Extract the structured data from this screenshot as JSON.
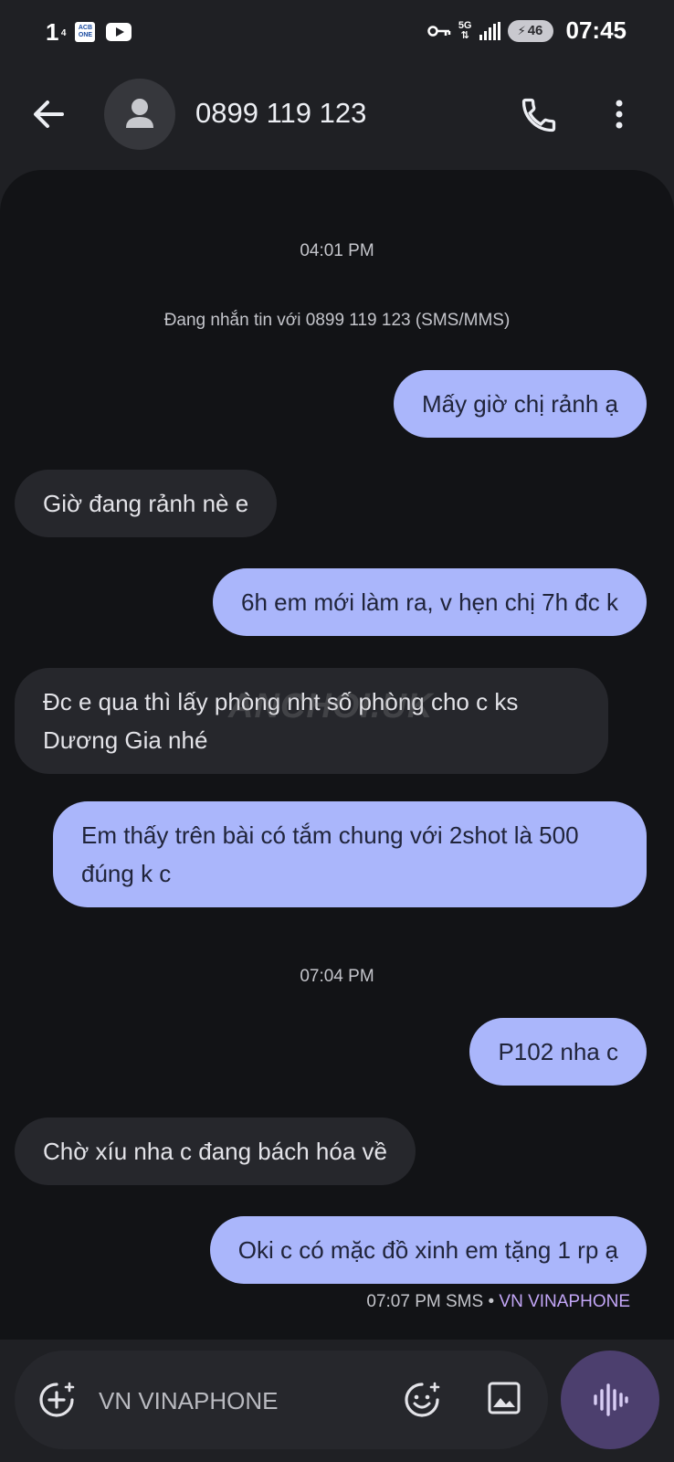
{
  "status_bar": {
    "left_number": "1",
    "left_superscript": "4",
    "acb_label": "ACB",
    "acb_sub": "ONE",
    "network": "5G",
    "battery": "46",
    "time": "07:45"
  },
  "header": {
    "contact": "0899 119 123"
  },
  "conversation": {
    "time_1": "04:01 PM",
    "info": "Đang nhắn tin với 0899 119 123 (SMS/MMS)",
    "messages": [
      {
        "text": "Mấy giờ chị rảnh ạ"
      },
      {
        "text": "Giờ đang rảnh nè e"
      },
      {
        "text": "6h em mới làm ra, v hẹn chị 7h đc k"
      },
      {
        "text": "Đc e qua thì lấy phòng nht số phòng cho c ks Dương Gia nhé"
      },
      {
        "text": "Em thấy trên bài có tắm chung với 2shot là 500 đúng k c"
      },
      {
        "text": "P102 nha c"
      },
      {
        "text": "Chờ xíu nha c đang bách hóa về"
      },
      {
        "text": "Oki c có mặc đồ xinh em tặng 1 rp ạ"
      }
    ],
    "time_2": "07:04 PM",
    "watermark": "ANCHOI.UK",
    "last_meta": {
      "time": "07:07 PM",
      "type": "SMS",
      "separator": "•",
      "carrier": "VN VINAPHONE"
    }
  },
  "composer": {
    "placeholder": "VN VINAPHONE"
  },
  "colors": {
    "outgoing_bubble": "#aab6fb",
    "incoming_bubble": "#26272c",
    "background": "#121316",
    "voice_button": "#4c3f6e",
    "carrier_accent": "#c3a6f7"
  }
}
